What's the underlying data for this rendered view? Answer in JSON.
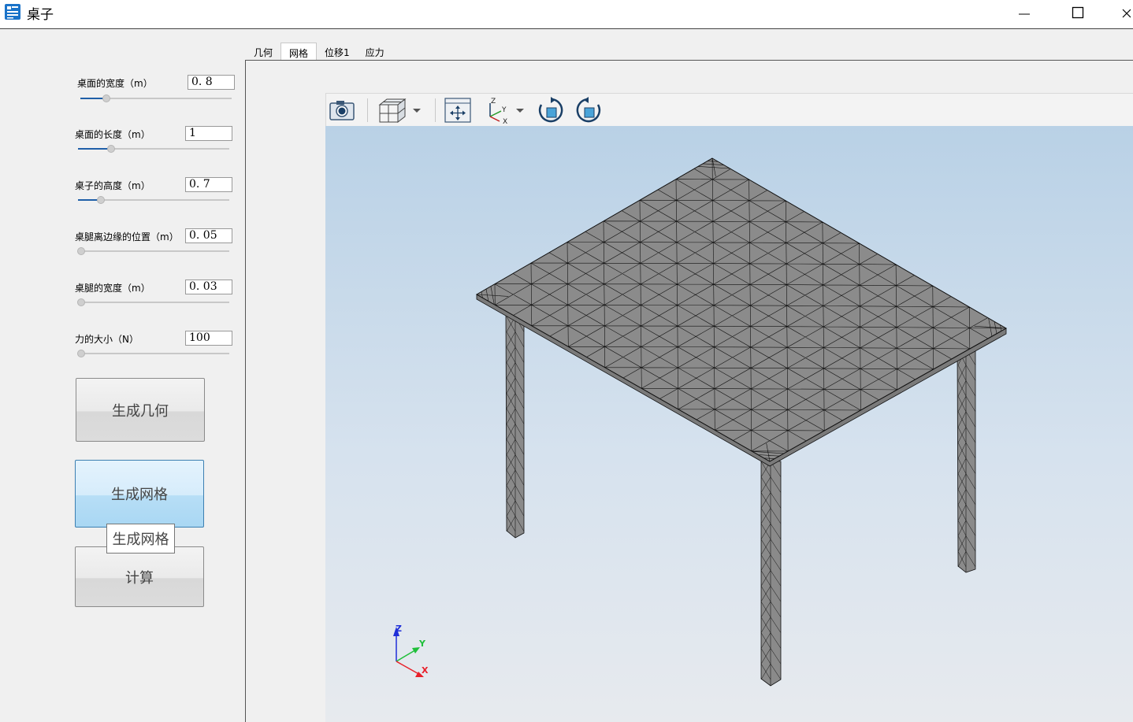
{
  "window": {
    "title": "桌子",
    "controls": [
      "minimize",
      "maximize",
      "close"
    ]
  },
  "tabs": [
    {
      "label": "几何",
      "selected": false
    },
    {
      "label": "网格",
      "selected": true
    },
    {
      "label": "位移1",
      "selected": false
    },
    {
      "label": "应力",
      "selected": false
    }
  ],
  "params": [
    {
      "label": "桌面的宽度（m）",
      "value": "0. 8",
      "slider_fraction": 0.15
    },
    {
      "label": "桌面的长度（m）",
      "value": "1",
      "slider_fraction": 0.2
    },
    {
      "label": "桌子的高度（m）",
      "value": "0. 7",
      "slider_fraction": 0.13
    },
    {
      "label": "桌腿离边缘的位置（m）",
      "value": "0. 05",
      "slider_fraction": 0.0
    },
    {
      "label": "桌腿的宽度（m）",
      "value": "0. 03",
      "slider_fraction": 0.0
    },
    {
      "label": "力的大小（N）",
      "value": "100",
      "slider_fraction": 0.0
    }
  ],
  "buttons": {
    "generate_geometry": "生成几何",
    "generate_mesh": "生成网格",
    "compute": "计算"
  },
  "tooltip": "生成网格",
  "toolbar": {
    "icons": [
      "camera-icon",
      "view-cube-icon",
      "fit-view-icon",
      "axis-orientation-icon",
      "rotate-cw-icon",
      "rotate-ccw-icon"
    ]
  },
  "triad": {
    "x_label": "X",
    "y_label": "Y",
    "z_label": "Z",
    "x_color": "#e8202a",
    "y_color": "#1fbf3a",
    "z_color": "#1f2fd8"
  },
  "colors": {
    "mesh_fill": "#8a8a8a",
    "mesh_edge": "#111111",
    "accent": "#1f5fa8"
  }
}
